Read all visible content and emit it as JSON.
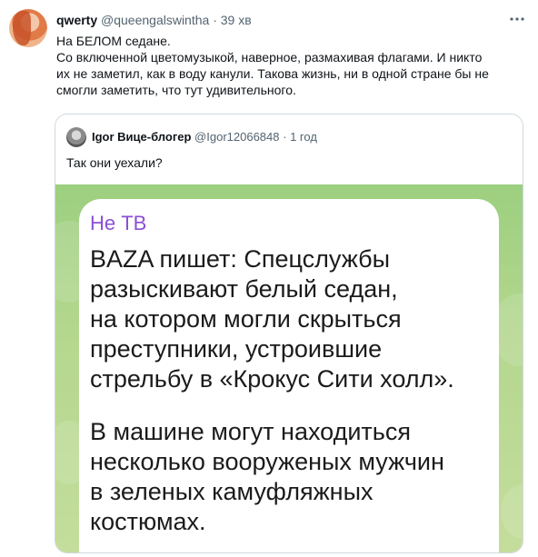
{
  "tweet": {
    "author_name": "qwerty",
    "author_handle": "@queengalswintha",
    "separator": "·",
    "time": "39 хв",
    "lines": [
      "На БЕЛОМ седане.",
      "Со включенной цветомузыкой, наверное, размахивая флагами. И никто",
      "их не заметил, как в воду канули. Такова жизнь, ни в одной стране бы не",
      "смогли заметить, что тут удивительного."
    ]
  },
  "icons": {
    "avatar": "user-avatar",
    "more": "more-options-icon",
    "quote_avatar": "quoted-user-avatar"
  },
  "quote": {
    "author_name": "Igor Вице-блогер",
    "author_handle": "@Igor12066848",
    "separator": "·",
    "time": "1 год",
    "text": "Так они уехали?",
    "image": {
      "source": "Не ТВ",
      "paragraph1": [
        "BAZA пишет: Спецслужбы",
        "разыскивают белый седан,",
        "на котором могли скрыться",
        "преступники, устроившие",
        "стрельбу в «Крокус Сити холл»."
      ],
      "paragraph2": [
        "В машине могут находиться",
        "несколько вооруженых мужчин",
        "в зеленых камуфляжных",
        "костюмах."
      ]
    }
  },
  "colors": {
    "accent_source": "#8b4fd6",
    "media_green": "#a9d487",
    "muted_text": "#536471"
  }
}
